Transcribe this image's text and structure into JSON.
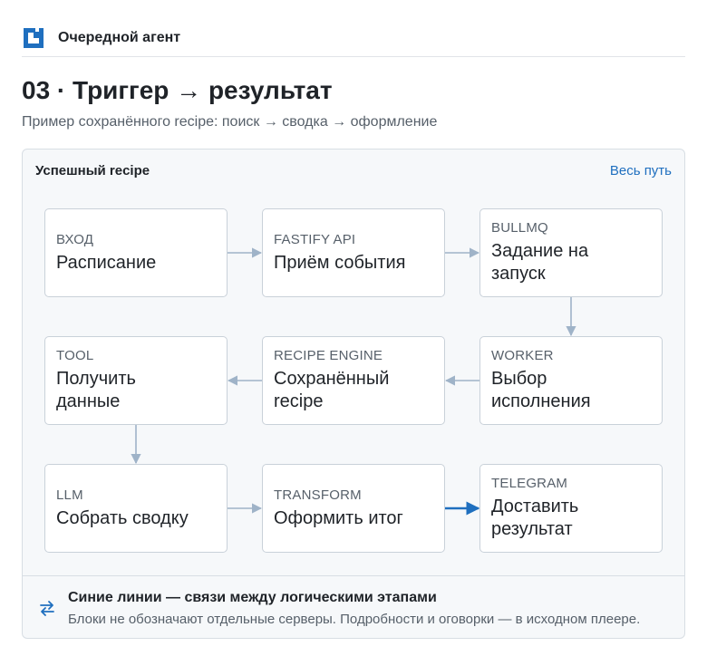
{
  "app": {
    "name": "Очередной агент",
    "logo_icon": "brand-logo-icon",
    "brand_color": "#1f6fbf"
  },
  "page": {
    "title": "03 · Триггер → результат",
    "subtitle": "Пример сохранённого recipe: поиск → сводка → оформление"
  },
  "panel": {
    "title": "Успешный recipe",
    "link_label": "Весь путь"
  },
  "diagram": {
    "nodes": [
      {
        "id": "input",
        "kicker": "ВХОД",
        "label": "Расписание"
      },
      {
        "id": "fastify",
        "kicker": "FASTIFY API",
        "label": "Приём события"
      },
      {
        "id": "bullmq",
        "kicker": "BULLMQ",
        "label": "Задание на запуск"
      },
      {
        "id": "worker",
        "kicker": "WORKER",
        "label": "Выбор исполнения"
      },
      {
        "id": "recipe",
        "kicker": "RECIPE ENGINE",
        "label": "Сохранённый recipe"
      },
      {
        "id": "tool",
        "kicker": "TOOL",
        "label": "Получить данные"
      },
      {
        "id": "llm",
        "kicker": "LLM",
        "label": "Собрать сводку"
      },
      {
        "id": "transform",
        "kicker": "TRANSFORM",
        "label": "Оформить итог"
      },
      {
        "id": "telegram",
        "kicker": "TELEGRAM",
        "label": "Доставить результат"
      }
    ],
    "edges": [
      {
        "from": "input",
        "to": "fastify"
      },
      {
        "from": "fastify",
        "to": "bullmq"
      },
      {
        "from": "bullmq",
        "to": "worker"
      },
      {
        "from": "worker",
        "to": "recipe"
      },
      {
        "from": "recipe",
        "to": "tool"
      },
      {
        "from": "tool",
        "to": "llm"
      },
      {
        "from": "llm",
        "to": "transform"
      },
      {
        "from": "transform",
        "to": "telegram",
        "emphasis": true
      }
    ],
    "colors": {
      "edge": "#9fb3c8",
      "edge_emphasis": "#1f6fbf"
    }
  },
  "legend": {
    "icon": "swap-arrows-icon",
    "title": "Синие линии — связи между логическими этапами",
    "text": "Блоки не обозначают отдельные серверы. Подробности и оговорки — в исходном плеере."
  }
}
